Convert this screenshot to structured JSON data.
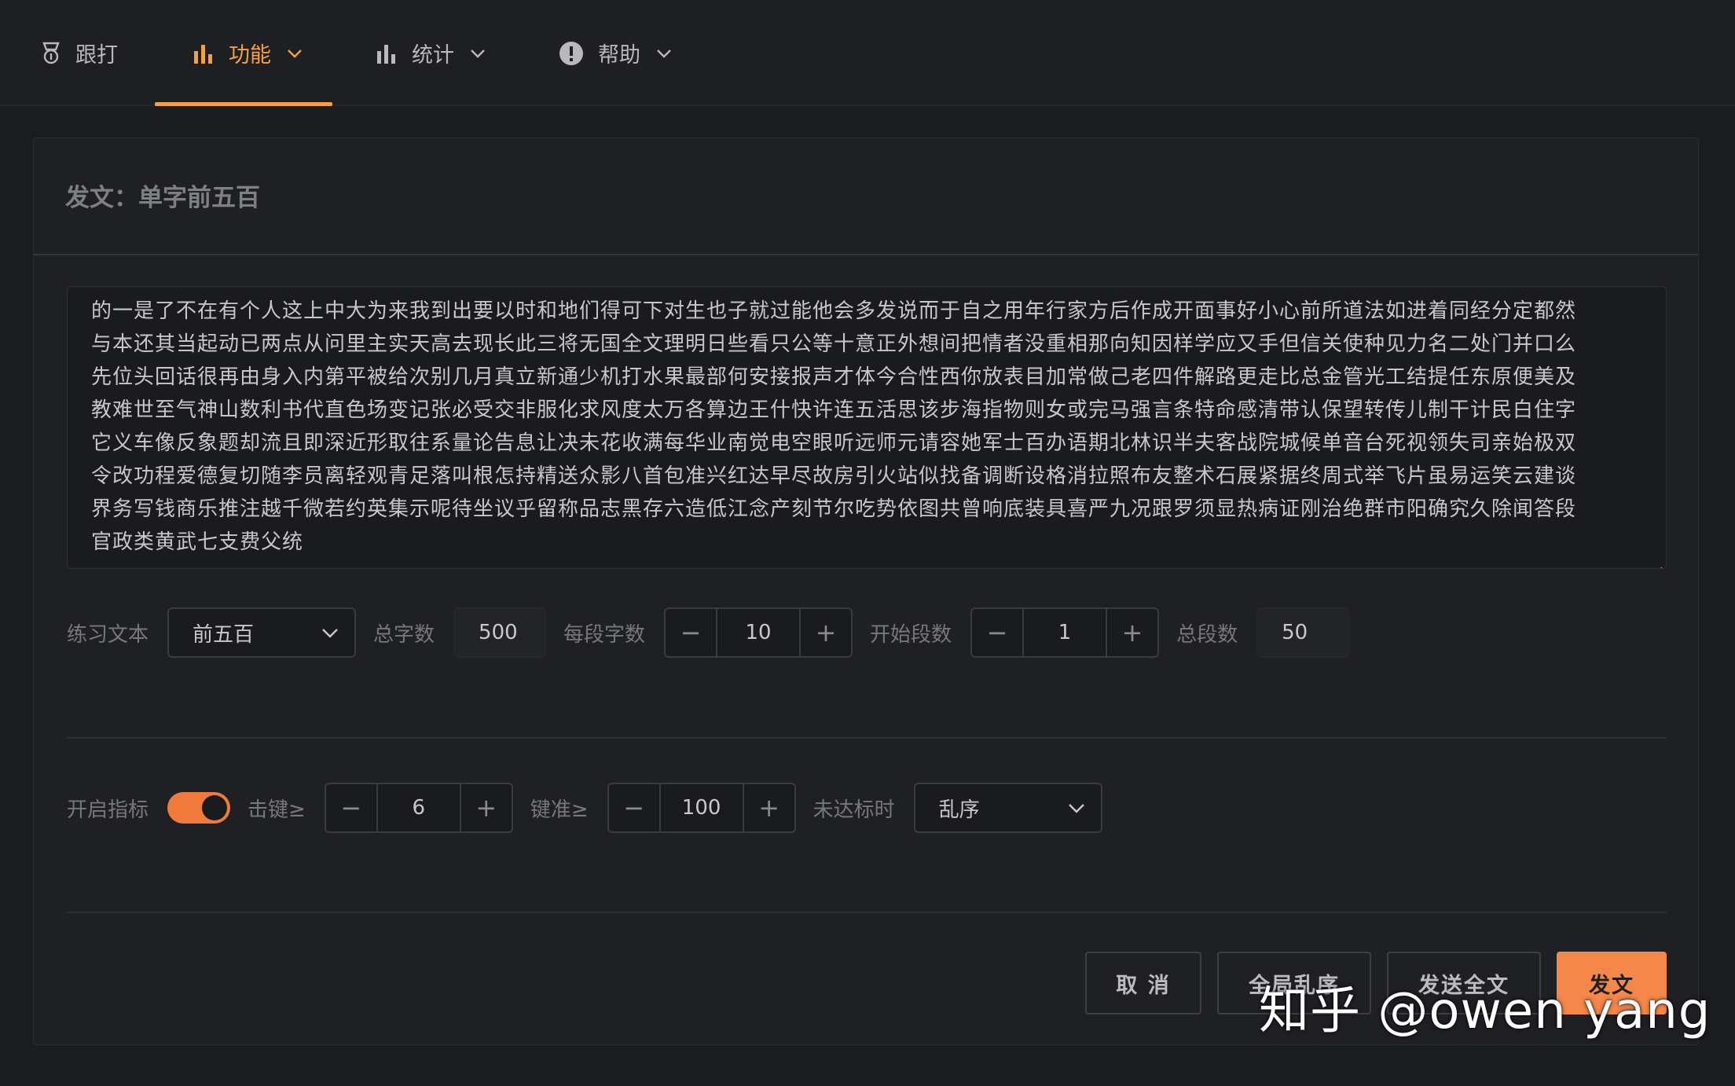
{
  "nav": {
    "tabs": [
      {
        "label": "跟打",
        "icon": "medal-icon"
      },
      {
        "label": "功能",
        "icon": "bar-chart-icon",
        "active": true
      },
      {
        "label": "统计",
        "icon": "bar-chart-icon"
      },
      {
        "label": "帮助",
        "icon": "info-icon"
      }
    ]
  },
  "card": {
    "title": "发文：单字前五百",
    "text_lines": [
      "的一是了不在有个人这上中大为来我到出要以时和地们得可下对生也子就过能他会多发说而于自之用年行家方后作成开面事好小心前所道法如进着同经分定都然",
      "与本还其当起动已两点从问里主实天高去现长此三将无国全文理明日些看只公等十意正外想间把情者没重相那向知因样学应又手但信关使种见力名二处门并口么",
      "先位头回话很再由身入内第平被给次别几月真立新通少机打水果最部何安接报声才体今合性西你放表目加常做己老四件解路更走比总金管光工结提任东原便美及",
      "教难世至气神山数利书代直色场变记张必受交非服化求风度太万各算边王什快许连五活思该步海指物则女或完马强言条特命感清带认保望转传儿制干计民白住字",
      "它义车像反象题却流且即深近形取往系量论告息让决未花收满每华业南觉电空眼听远师元请容她军士百办语期北林识半夫客战院城候单音台死视领失司亲始极双",
      "令改功程爱德复切随李员离轻观青足落叫根怎持精送众影八首包准兴红达早尽故房引火站似找备调断设格消拉照布友整术石展紧据终周式举飞片虽易运笑云建谈",
      "界务写钱商乐推注越千微若约英集示呢待坐议乎留称品志黑存六造低江念产刻节尔吃势依图共曾响底装具喜严九况跟罗须显热病证刚治绝群市阳确究久除闻答段",
      "官政类黄武七支费父统"
    ],
    "settings": {
      "practice_text_label": "练习文本",
      "practice_text_value": "前五百",
      "total_chars_label": "总字数",
      "total_chars_value": "500",
      "chars_per_seg_label": "每段字数",
      "chars_per_seg_value": "10",
      "start_seg_label": "开始段数",
      "start_seg_value": "1",
      "total_segs_label": "总段数",
      "total_segs_value": "50"
    },
    "indicators": {
      "enable_label": "开启指标",
      "enabled": true,
      "keystroke_label": "击键≥",
      "keystroke_value": "6",
      "accuracy_label": "键准≥",
      "accuracy_value": "100",
      "fail_label": "未达标时",
      "fail_value": "乱序"
    },
    "actions": {
      "cancel": "取 消",
      "global_shuffle": "全局乱序",
      "send_full": "发送全文",
      "send": "发文"
    }
  },
  "watermark": "知乎 @owen yang",
  "colors": {
    "accent": "#f5a046",
    "primary_button": "#f6874a",
    "toggle_on": "#f07a3c",
    "background": "#1b1c20"
  }
}
